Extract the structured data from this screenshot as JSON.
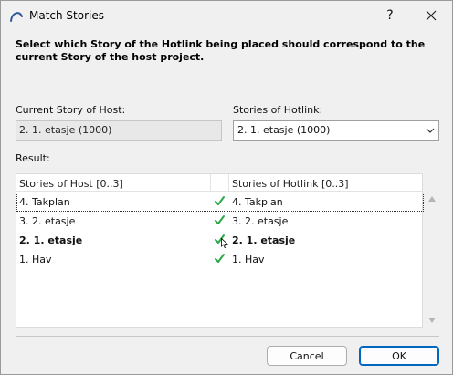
{
  "window": {
    "title": "Match Stories",
    "help_label": "?",
    "close_icon": "close-icon",
    "app_icon": "archicad-arc-icon"
  },
  "instruction": "Select which Story of the Hotlink being placed should correspond to the current Story of the host project.",
  "host": {
    "label": "Current Story of Host:",
    "value": "2. 1. etasje (1000)"
  },
  "hotlink": {
    "label": "Stories of Hotlink:",
    "selected": "2. 1. etasje (1000)"
  },
  "result": {
    "label": "Result:",
    "columns": [
      "Stories of Host [0..3]",
      "Stories of Hotlink [0..3]"
    ],
    "rows": [
      {
        "host": "4. Takplan",
        "hotlink": "4. Takplan",
        "matched": true,
        "bold": false,
        "selected": true
      },
      {
        "host": "3. 2. etasje",
        "hotlink": "3. 2. etasje",
        "matched": true,
        "bold": false,
        "selected": false
      },
      {
        "host": "2. 1. etasje",
        "hotlink": "2. 1. etasje",
        "matched": true,
        "bold": true,
        "selected": false
      },
      {
        "host": "1. Hav",
        "hotlink": "1. Hav",
        "matched": true,
        "bold": false,
        "selected": false
      }
    ]
  },
  "buttons": {
    "cancel": "Cancel",
    "ok": "OK"
  },
  "colors": {
    "check": "#2aa84a",
    "ok_border": "#0067c0",
    "accent_icon": "#2b5797"
  }
}
